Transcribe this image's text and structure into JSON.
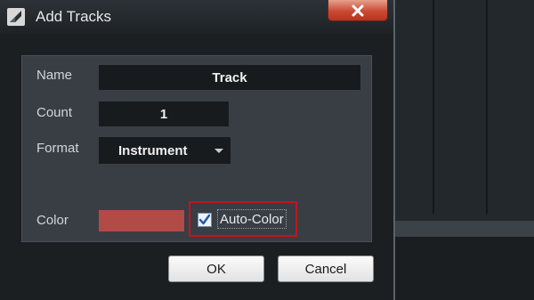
{
  "dialog": {
    "title": "Add Tracks",
    "app_icon": "studio-logo-icon",
    "close_icon": "close-x-icon"
  },
  "form": {
    "name_label": "Name",
    "name_value": "Track",
    "count_label": "Count",
    "count_value": "1",
    "format_label": "Format",
    "format_value": "Instrument",
    "format_icon": "chevron-down-icon",
    "color_label": "Color",
    "color_value": "#b24a45",
    "auto_color_label": "Auto-Color",
    "auto_color_checked": true
  },
  "buttons": {
    "ok_label": "OK",
    "cancel_label": "Cancel"
  },
  "colors": {
    "highlight": "#c0161b",
    "close_button": "#c94a32"
  }
}
